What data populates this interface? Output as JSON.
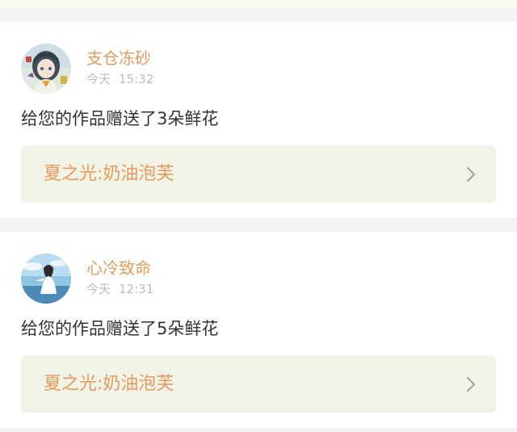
{
  "notifications": [
    {
      "username": "支仓冻砂",
      "time_day": "今天",
      "time_clock": "15:32",
      "message": "给您的作品赠送了3朵鲜花",
      "work_title": "夏之光:奶油泡芙",
      "avatar_icon": "anime-girl-avatar-icon"
    },
    {
      "username": "心冷致命",
      "time_day": "今天",
      "time_clock": "12:31",
      "message": "给您的作品赠送了5朵鲜花",
      "work_title": "夏之光:奶油泡芙",
      "avatar_icon": "sky-figure-avatar-icon"
    }
  ],
  "colors": {
    "accent": "#e59a5e",
    "link_bg": "#f1f3e6",
    "page_bg": "#f3f3f3",
    "text": "#333333",
    "muted": "#bdbdbd"
  }
}
